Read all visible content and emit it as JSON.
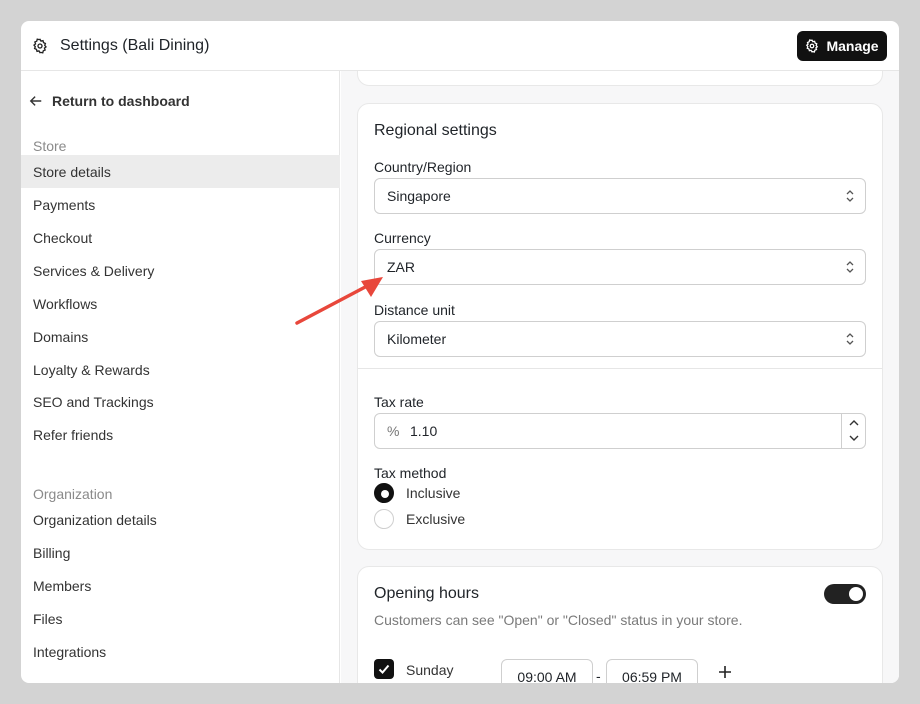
{
  "header": {
    "title": "Settings (Bali Dining)",
    "manage_label": "Manage"
  },
  "sidebar": {
    "back_label": "Return to dashboard",
    "store_section": "Store",
    "store_items": [
      {
        "label": "Store details",
        "active": true
      },
      {
        "label": "Payments"
      },
      {
        "label": "Checkout"
      },
      {
        "label": "Services & Delivery"
      },
      {
        "label": "Workflows"
      },
      {
        "label": "Domains"
      },
      {
        "label": "Loyalty & Rewards"
      },
      {
        "label": "SEO and Trackings"
      },
      {
        "label": "Refer friends"
      }
    ],
    "org_section": "Organization",
    "org_items": [
      {
        "label": "Organization details"
      },
      {
        "label": "Billing"
      },
      {
        "label": "Members"
      },
      {
        "label": "Files"
      },
      {
        "label": "Integrations"
      }
    ]
  },
  "regional": {
    "title": "Regional settings",
    "country_label": "Country/Region",
    "country_value": "Singapore",
    "currency_label": "Currency",
    "currency_value": "ZAR",
    "distance_label": "Distance unit",
    "distance_value": "Kilometer",
    "tax_rate_label": "Tax rate",
    "tax_rate_prefix": "%",
    "tax_rate_value": "1.10",
    "tax_method_label": "Tax method",
    "tax_options": [
      {
        "label": "Inclusive",
        "selected": true
      },
      {
        "label": "Exclusive",
        "selected": false
      }
    ]
  },
  "opening_hours": {
    "title": "Opening hours",
    "description": "Customers can see \"Open\" or \"Closed\" status in your store.",
    "enabled": true,
    "day": "Sunday",
    "day_checked": true,
    "open_time": "09:00 AM",
    "separator": "-",
    "close_time": "06:59 PM"
  },
  "colors": {
    "accent": "#111111",
    "annotation_arrow": "#e8473b",
    "active_nav_bg": "#ececec"
  },
  "icons": {
    "header": "gear-icon",
    "back": "arrow-left-icon",
    "select": "chevron-updown-icon",
    "add": "plus-icon"
  }
}
